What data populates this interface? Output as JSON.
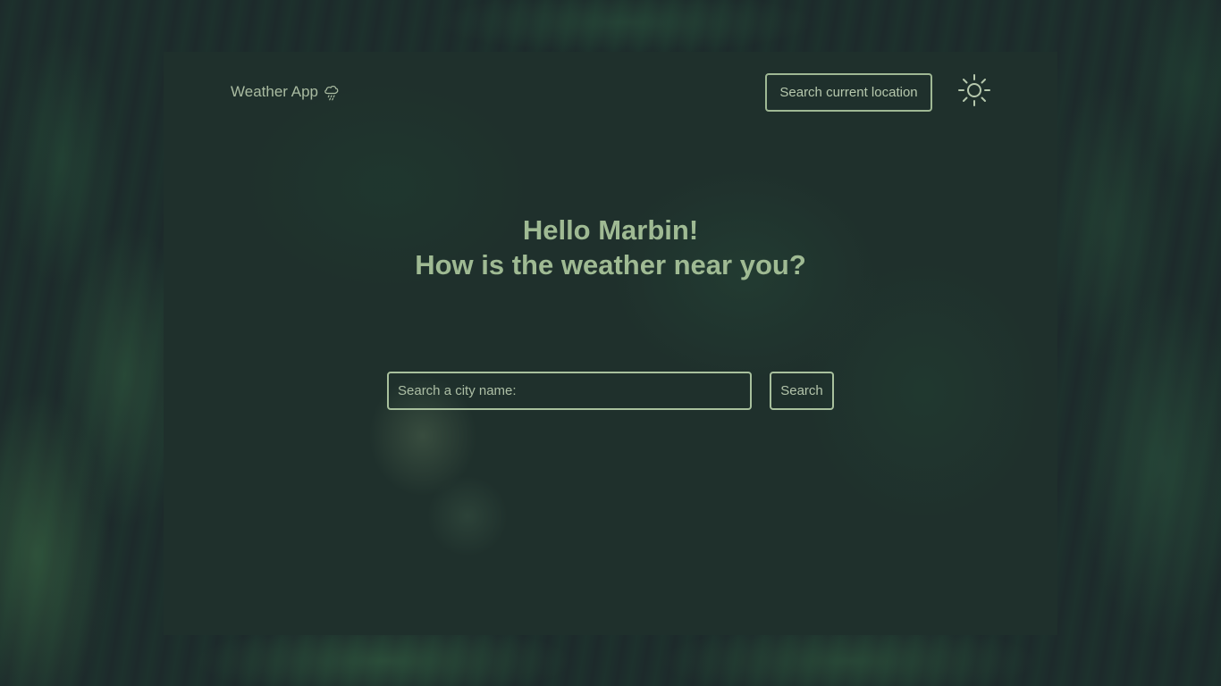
{
  "app": {
    "title": "Weather App",
    "brand_icon": "cloud-rain-icon"
  },
  "header": {
    "location_button_label": "Search current location",
    "theme_toggle_icon": "sun-icon"
  },
  "greeting": {
    "line1": "Hello Marbin!",
    "line2": "How is the weather near you?"
  },
  "search": {
    "placeholder": "Search a city name:",
    "value": "",
    "button_label": "Search"
  },
  "colors": {
    "accent": "#a8c09d",
    "heading": "#9fba93",
    "panel": "#1f302c",
    "background": "#1d2a2b"
  }
}
